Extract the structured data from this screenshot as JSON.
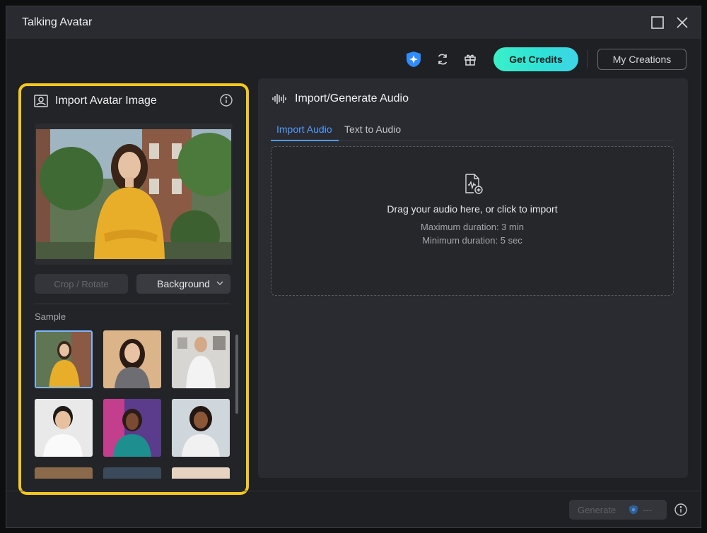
{
  "window": {
    "title": "Talking Avatar"
  },
  "toolbar": {
    "get_credits": "Get Credits",
    "my_creations": "My Creations"
  },
  "left_panel": {
    "title": "Import Avatar Image",
    "crop_rotate": "Crop / Rotate",
    "background": "Background",
    "sample_label": "Sample"
  },
  "right_panel": {
    "title": "Import/Generate Audio",
    "tabs": [
      {
        "label": "Import Audio",
        "active": true
      },
      {
        "label": "Text to Audio",
        "active": false
      }
    ],
    "drop_zone": {
      "main": "Drag your audio here, or click to import",
      "max": "Maximum duration: 3 min",
      "min": "Minimum duration: 5 sec"
    }
  },
  "footer": {
    "generate": "Generate",
    "credit_cost": "---"
  },
  "colors": {
    "highlight": "#f2c81c",
    "accent_blue": "#4f9bff",
    "credits_gradient_start": "#39f0c8",
    "credits_gradient_end": "#3fd4e6"
  }
}
